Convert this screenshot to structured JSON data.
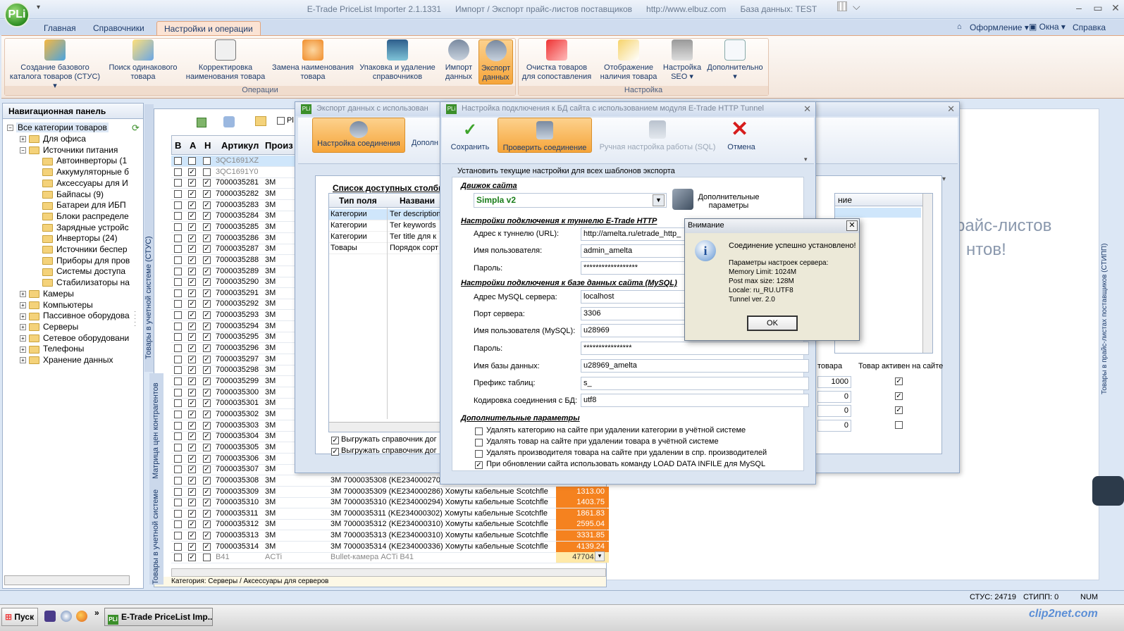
{
  "app": {
    "title": "E-Trade PriceList Importer 2.1.1331",
    "subtitle": "Импорт / Экспорт прайс-листов поставщиков",
    "url": "http://www.elbuz.com",
    "db": "База данных: TEST",
    "logo": "PLi"
  },
  "ribbon_tabs": [
    "Главная",
    "Справочники",
    "Настройки и операции"
  ],
  "ribbon_right": [
    "Оформление",
    "Окна",
    "Справка"
  ],
  "ribbon_groups": {
    "operations": "Операции",
    "settings": "Настройка",
    "buttons": [
      {
        "label": "Создание базового каталога товаров (СТУС)"
      },
      {
        "label": "Поиск одинакового товара"
      },
      {
        "label": "Корректировка наименования товара"
      },
      {
        "label": "Замена наименования товара"
      },
      {
        "label": "Упаковка и удаление справочников"
      },
      {
        "label": "Импорт данных"
      },
      {
        "label": "Экспорт данных"
      },
      {
        "label": "Очистка товаров для сопоставления"
      },
      {
        "label": "Отображение наличия товара"
      },
      {
        "label": "Настройка SEO"
      },
      {
        "label": "Дополнительно"
      }
    ]
  },
  "nav": {
    "title": "Навигационная панель",
    "root": "Все категории товаров",
    "items": [
      {
        "label": "Для офиса",
        "level": 1,
        "pm": "+"
      },
      {
        "label": "Источники питания",
        "level": 1,
        "pm": "-"
      },
      {
        "label": "Автоинверторы (1",
        "level": 2
      },
      {
        "label": "Аккумуляторные б",
        "level": 2
      },
      {
        "label": "Аксессуары для И",
        "level": 2
      },
      {
        "label": "Байпасы (9)",
        "level": 2
      },
      {
        "label": "Батареи для ИБП",
        "level": 2
      },
      {
        "label": "Блоки распределе",
        "level": 2
      },
      {
        "label": "Зарядные устройс",
        "level": 2
      },
      {
        "label": "Инверторы (24)",
        "level": 2
      },
      {
        "label": "Источники беспер",
        "level": 2
      },
      {
        "label": "Приборы для пров",
        "level": 2
      },
      {
        "label": "Системы доступа",
        "level": 2
      },
      {
        "label": "Стабилизаторы на",
        "level": 2
      },
      {
        "label": "Камеры",
        "level": 1,
        "pm": "+"
      },
      {
        "label": "Компьютеры",
        "level": 1,
        "pm": "+"
      },
      {
        "label": "Пассивное оборудова",
        "level": 1,
        "pm": "+"
      },
      {
        "label": "Серверы",
        "level": 1,
        "pm": "+"
      },
      {
        "label": "Сетевое оборудовани",
        "level": 1,
        "pm": "+"
      },
      {
        "label": "Телефоны",
        "level": 1,
        "pm": "+"
      },
      {
        "label": "Хранение данных",
        "level": 1,
        "pm": "+"
      }
    ]
  },
  "side_tabs": {
    "tab1": "Товары в учетной системе (СТУС)",
    "tab2": "Матрица цен контрагентов",
    "tab3": "Товары в учетной системе"
  },
  "grid": {
    "headers": [
      "В",
      "А",
      "Н",
      "Артикул",
      "Произ"
    ],
    "rows": [
      {
        "a": false,
        "n": false,
        "art": "3QC1691XZ",
        "mfr": "",
        "name": "",
        "price": ""
      },
      {
        "a": true,
        "n": false,
        "art": "3QC1691Y0",
        "mfr": "",
        "name": "",
        "price": ""
      },
      {
        "a": true,
        "n": true,
        "art": "7000035281",
        "mfr": "3M",
        "name": "",
        "price": ""
      },
      {
        "a": true,
        "n": true,
        "art": "7000035282",
        "mfr": "3M",
        "name": "",
        "price": ""
      },
      {
        "a": true,
        "n": true,
        "art": "7000035283",
        "mfr": "3M",
        "name": "",
        "price": ""
      },
      {
        "a": true,
        "n": true,
        "art": "7000035284",
        "mfr": "3M",
        "name": "",
        "price": ""
      },
      {
        "a": true,
        "n": true,
        "art": "7000035285",
        "mfr": "3M",
        "name": "",
        "price": ""
      },
      {
        "a": true,
        "n": true,
        "art": "7000035286",
        "mfr": "3M",
        "name": "",
        "price": ""
      },
      {
        "a": true,
        "n": true,
        "art": "7000035287",
        "mfr": "3M",
        "name": "",
        "price": ""
      },
      {
        "a": true,
        "n": true,
        "art": "7000035288",
        "mfr": "3M",
        "name": "",
        "price": ""
      },
      {
        "a": true,
        "n": true,
        "art": "7000035289",
        "mfr": "3M",
        "name": "",
        "price": ""
      },
      {
        "a": true,
        "n": true,
        "art": "7000035290",
        "mfr": "3M",
        "name": "",
        "price": ""
      },
      {
        "a": true,
        "n": true,
        "art": "7000035291",
        "mfr": "3M",
        "name": "",
        "price": ""
      },
      {
        "a": true,
        "n": true,
        "art": "7000035292",
        "mfr": "3M",
        "name": "",
        "price": ""
      },
      {
        "a": true,
        "n": true,
        "art": "7000035293",
        "mfr": "3M",
        "name": "",
        "price": ""
      },
      {
        "a": true,
        "n": true,
        "art": "7000035294",
        "mfr": "3M",
        "name": "",
        "price": ""
      },
      {
        "a": true,
        "n": true,
        "art": "7000035295",
        "mfr": "3M",
        "name": "",
        "price": ""
      },
      {
        "a": true,
        "n": true,
        "art": "7000035296",
        "mfr": "3M",
        "name": "",
        "price": ""
      },
      {
        "a": true,
        "n": true,
        "art": "7000035297",
        "mfr": "3M",
        "name": "",
        "price": ""
      },
      {
        "a": true,
        "n": true,
        "art": "7000035298",
        "mfr": "3M",
        "name": "",
        "price": ""
      },
      {
        "a": true,
        "n": true,
        "art": "7000035299",
        "mfr": "3M",
        "name": "",
        "price": ""
      },
      {
        "a": true,
        "n": true,
        "art": "7000035300",
        "mfr": "3M",
        "name": "",
        "price": ""
      },
      {
        "a": true,
        "n": true,
        "art": "7000035301",
        "mfr": "3M",
        "name": "",
        "price": ""
      },
      {
        "a": true,
        "n": true,
        "art": "7000035302",
        "mfr": "3M",
        "name": "",
        "price": ""
      },
      {
        "a": true,
        "n": true,
        "art": "7000035303",
        "mfr": "3M",
        "name": "",
        "price": ""
      },
      {
        "a": true,
        "n": true,
        "art": "7000035304",
        "mfr": "3M",
        "name": "",
        "price": ""
      },
      {
        "a": true,
        "n": true,
        "art": "7000035305",
        "mfr": "3M",
        "name": "",
        "price": ""
      },
      {
        "a": true,
        "n": true,
        "art": "7000035306",
        "mfr": "3M",
        "name": "",
        "price": ""
      },
      {
        "a": true,
        "n": true,
        "art": "7000035307",
        "mfr": "3M",
        "name": "",
        "price": ""
      },
      {
        "a": true,
        "n": true,
        "art": "7000035308",
        "mfr": "3M",
        "name": "3M 7000035308 (KE234000270) Хомуты кабельные Scotchfle",
        "price": ""
      },
      {
        "a": true,
        "n": true,
        "art": "7000035309",
        "mfr": "3M",
        "name": "3M 7000035309 (KE234000286) Хомуты кабельные Scotchfle",
        "price": "1313.00"
      },
      {
        "a": true,
        "n": true,
        "art": "7000035310",
        "mfr": "3M",
        "name": "3M 7000035310 (KE234000294) Хомуты кабельные Scotchfle",
        "price": "1403.75"
      },
      {
        "a": true,
        "n": true,
        "art": "7000035311",
        "mfr": "3M",
        "name": "3M 7000035311 (KE234000302) Хомуты кабельные Scotchfle",
        "price": "1861.83"
      },
      {
        "a": true,
        "n": true,
        "art": "7000035312",
        "mfr": "3M",
        "name": "3M 7000035312 (KE234000310) Хомуты кабельные Scotchfle",
        "price": "2595.04"
      },
      {
        "a": true,
        "n": true,
        "art": "7000035313",
        "mfr": "3M",
        "name": "3M 7000035313 (KE234000310) Хомуты кабельные Scotchfle",
        "price": "3331.85"
      },
      {
        "a": true,
        "n": true,
        "art": "7000035314",
        "mfr": "3M",
        "name": "3M 7000035314 (KE234000336) Хомуты кабельные Scotchfle",
        "price": "4139.24"
      },
      {
        "a": true,
        "n": false,
        "art": "B41",
        "mfr": "ACTi",
        "name": "Bullet-камера ACTi B41",
        "price": "47704.16"
      }
    ],
    "category_footer": "Категория: Серверы / Аксессуары для серверов"
  },
  "bg_text": [
    "райс-листов",
    "нтов!"
  ],
  "bg_vertical": "Товары в прайс-листах поставщиков (СТИПП)",
  "export_window": {
    "title": "Экспорт данных с использован",
    "btn_conn": "Настройка соединения",
    "btn_more": "Дополн",
    "list_title": "Список доступных столбц",
    "col_type": "Тип поля",
    "col_name": "Названи",
    "rows": [
      {
        "type": "Категории",
        "name": "Тег description"
      },
      {
        "type": "Категории",
        "name": "Тег keywords"
      },
      {
        "type": "Категории",
        "name": "Тег title для к"
      },
      {
        "type": "Товары",
        "name": "Порядок сорт"
      }
    ],
    "chk1": "Выгружать справочник дог",
    "chk2": "Выгружать справочник дог",
    "right_col1": "ние",
    "right_hdr1": "товара",
    "right_hdr2": "Товар активен на сайте",
    "right_vals": [
      "1000",
      "0",
      "0",
      "0"
    ],
    "right_checks": [
      true,
      true,
      true,
      false
    ]
  },
  "conn_window": {
    "title": "Настройка подключения к БД сайта с использованием модуля E-Trade HTTP Tunnel",
    "btn_save": "Сохранить",
    "btn_check": "Проверить соединение",
    "btn_sql": "Ручная настройка работы (SQL)",
    "btn_cancel": "Отмена",
    "apply_all": "Установить текущие настройки для всех шаблонов экспорта",
    "engine_section": "Движок сайта",
    "engine_value": "Simpla v2",
    "extra_params": "Дополнительные параметры",
    "tunnel_section": "Настройки подключения к туннелю E-Trade HTTP",
    "tunnel_url_label": "Адрес к туннелю (URL):",
    "tunnel_url": "http://amelta.ru/etrade_http_",
    "tunnel_user_label": "Имя пользователя:",
    "tunnel_user": "admin_amelta",
    "tunnel_pass_label": "Пароль:",
    "tunnel_pass": "******************",
    "mysql_section": "Настройки подключения к базе данных сайта (MySQL)",
    "mysql_host_label": "Адрес MySQL сервера:",
    "mysql_host": "localhost",
    "mysql_port_label": "Порт сервера:",
    "mysql_port": "3306",
    "mysql_user_label": "Имя пользователя (MySQL):",
    "mysql_user": "u28969",
    "mysql_pass_label": "Пароль:",
    "mysql_pass": "****************",
    "mysql_db_label": "Имя базы данных:",
    "mysql_db": "u28969_amelta",
    "prefix_label": "Префикс таблиц:",
    "prefix": "s_",
    "charset_label": "Кодировка соединения с БД:",
    "charset": "utf8",
    "extra_section": "Дополнительные параметры",
    "opt1": "Удалять категорию на сайте при удалении категории в учётной системе",
    "opt2": "Удалять товар на сайте при удалении товара в учётной системе",
    "opt3": "Удалять производителя товара на сайте при удалении в спр. производителей",
    "opt4": "При обновлении сайта использовать команду LOAD DATA INFILE для MySQL"
  },
  "dialog": {
    "title": "Внимание",
    "message": "Соединение успешно установлено!",
    "params_title": "Параметры настроек сервера:",
    "memory": "Memory Limit: 1024M",
    "post": "Post max size: 128M",
    "locale": "Locale: ru_RU.UTF8",
    "tunnel": "Tunnel ver. 2.0",
    "ok": "OK"
  },
  "status": {
    "stus": "СТУС: 24719",
    "stipp": "СТИПП: 0",
    "num": "NUM"
  },
  "taskbar": {
    "start": "Пуск",
    "task": "E-Trade PriceList Imp...",
    "watermark": "clip2net.com"
  }
}
